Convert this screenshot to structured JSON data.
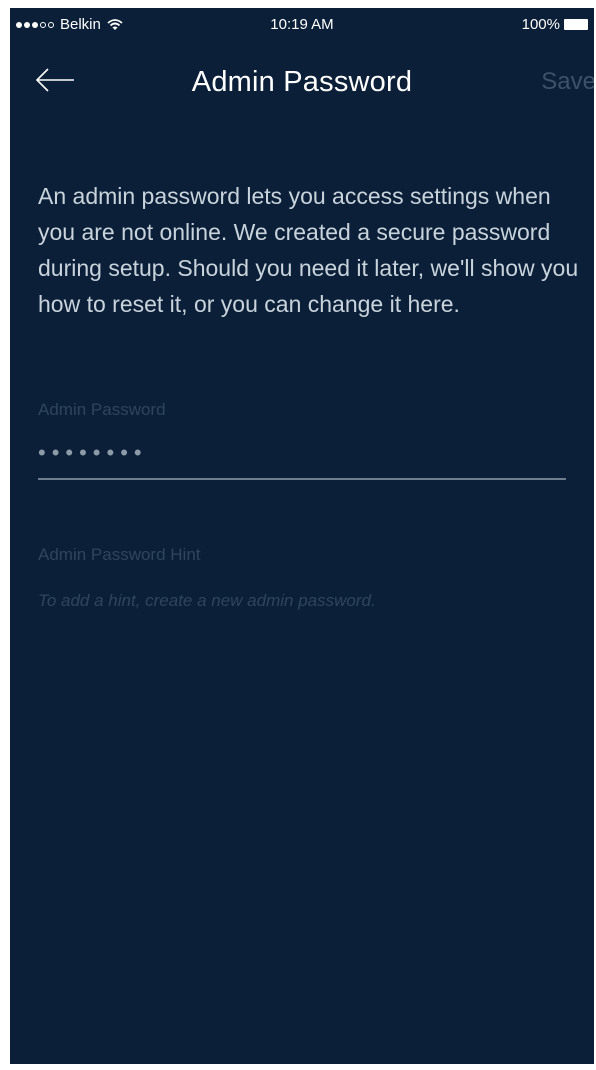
{
  "status_bar": {
    "carrier": "Belkin",
    "signal_filled": 3,
    "signal_total": 5,
    "time": "10:19 AM",
    "battery": "100%"
  },
  "header": {
    "title": "Admin Password",
    "save_label": "Save"
  },
  "description": "An admin password lets you access settings when you are not online. We created a secure password during setup. Should you need it later, we'll show you how to reset it, or you can change it here.",
  "password_field": {
    "label": "Admin Password",
    "value": "••••••••"
  },
  "hint_field": {
    "label": "Admin Password Hint",
    "placeholder": "To add a hint, create a new admin password."
  },
  "colors": {
    "background": "#0b2038",
    "text": "#ffffff",
    "muted": "#2f455c",
    "disabled_action": "#3d5268"
  },
  "icons": {
    "back": "arrow-left-icon",
    "wifi": "wifi-icon",
    "battery": "battery-icon"
  }
}
